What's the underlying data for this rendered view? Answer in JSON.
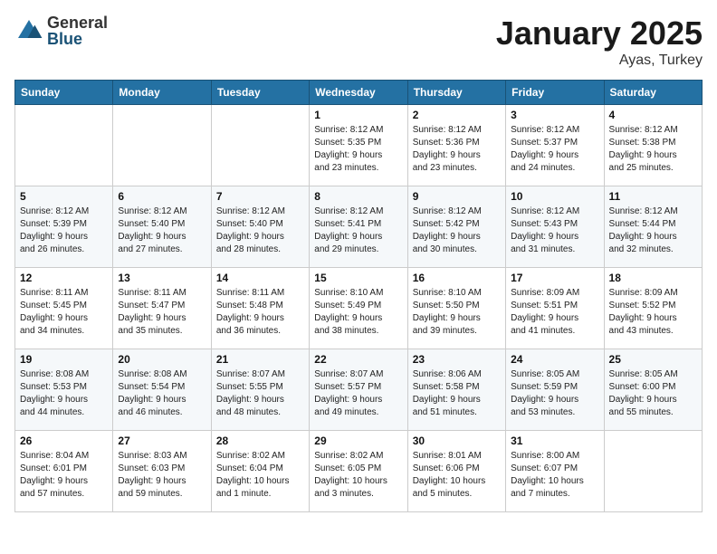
{
  "logo": {
    "general": "General",
    "blue": "Blue"
  },
  "title": "January 2025",
  "location": "Ayas, Turkey",
  "weekdays": [
    "Sunday",
    "Monday",
    "Tuesday",
    "Wednesday",
    "Thursday",
    "Friday",
    "Saturday"
  ],
  "weeks": [
    [
      {
        "day": "",
        "info": ""
      },
      {
        "day": "",
        "info": ""
      },
      {
        "day": "",
        "info": ""
      },
      {
        "day": "1",
        "info": "Sunrise: 8:12 AM\nSunset: 5:35 PM\nDaylight: 9 hours\nand 23 minutes."
      },
      {
        "day": "2",
        "info": "Sunrise: 8:12 AM\nSunset: 5:36 PM\nDaylight: 9 hours\nand 23 minutes."
      },
      {
        "day": "3",
        "info": "Sunrise: 8:12 AM\nSunset: 5:37 PM\nDaylight: 9 hours\nand 24 minutes."
      },
      {
        "day": "4",
        "info": "Sunrise: 8:12 AM\nSunset: 5:38 PM\nDaylight: 9 hours\nand 25 minutes."
      }
    ],
    [
      {
        "day": "5",
        "info": "Sunrise: 8:12 AM\nSunset: 5:39 PM\nDaylight: 9 hours\nand 26 minutes."
      },
      {
        "day": "6",
        "info": "Sunrise: 8:12 AM\nSunset: 5:40 PM\nDaylight: 9 hours\nand 27 minutes."
      },
      {
        "day": "7",
        "info": "Sunrise: 8:12 AM\nSunset: 5:40 PM\nDaylight: 9 hours\nand 28 minutes."
      },
      {
        "day": "8",
        "info": "Sunrise: 8:12 AM\nSunset: 5:41 PM\nDaylight: 9 hours\nand 29 minutes."
      },
      {
        "day": "9",
        "info": "Sunrise: 8:12 AM\nSunset: 5:42 PM\nDaylight: 9 hours\nand 30 minutes."
      },
      {
        "day": "10",
        "info": "Sunrise: 8:12 AM\nSunset: 5:43 PM\nDaylight: 9 hours\nand 31 minutes."
      },
      {
        "day": "11",
        "info": "Sunrise: 8:12 AM\nSunset: 5:44 PM\nDaylight: 9 hours\nand 32 minutes."
      }
    ],
    [
      {
        "day": "12",
        "info": "Sunrise: 8:11 AM\nSunset: 5:45 PM\nDaylight: 9 hours\nand 34 minutes."
      },
      {
        "day": "13",
        "info": "Sunrise: 8:11 AM\nSunset: 5:47 PM\nDaylight: 9 hours\nand 35 minutes."
      },
      {
        "day": "14",
        "info": "Sunrise: 8:11 AM\nSunset: 5:48 PM\nDaylight: 9 hours\nand 36 minutes."
      },
      {
        "day": "15",
        "info": "Sunrise: 8:10 AM\nSunset: 5:49 PM\nDaylight: 9 hours\nand 38 minutes."
      },
      {
        "day": "16",
        "info": "Sunrise: 8:10 AM\nSunset: 5:50 PM\nDaylight: 9 hours\nand 39 minutes."
      },
      {
        "day": "17",
        "info": "Sunrise: 8:09 AM\nSunset: 5:51 PM\nDaylight: 9 hours\nand 41 minutes."
      },
      {
        "day": "18",
        "info": "Sunrise: 8:09 AM\nSunset: 5:52 PM\nDaylight: 9 hours\nand 43 minutes."
      }
    ],
    [
      {
        "day": "19",
        "info": "Sunrise: 8:08 AM\nSunset: 5:53 PM\nDaylight: 9 hours\nand 44 minutes."
      },
      {
        "day": "20",
        "info": "Sunrise: 8:08 AM\nSunset: 5:54 PM\nDaylight: 9 hours\nand 46 minutes."
      },
      {
        "day": "21",
        "info": "Sunrise: 8:07 AM\nSunset: 5:55 PM\nDaylight: 9 hours\nand 48 minutes."
      },
      {
        "day": "22",
        "info": "Sunrise: 8:07 AM\nSunset: 5:57 PM\nDaylight: 9 hours\nand 49 minutes."
      },
      {
        "day": "23",
        "info": "Sunrise: 8:06 AM\nSunset: 5:58 PM\nDaylight: 9 hours\nand 51 minutes."
      },
      {
        "day": "24",
        "info": "Sunrise: 8:05 AM\nSunset: 5:59 PM\nDaylight: 9 hours\nand 53 minutes."
      },
      {
        "day": "25",
        "info": "Sunrise: 8:05 AM\nSunset: 6:00 PM\nDaylight: 9 hours\nand 55 minutes."
      }
    ],
    [
      {
        "day": "26",
        "info": "Sunrise: 8:04 AM\nSunset: 6:01 PM\nDaylight: 9 hours\nand 57 minutes."
      },
      {
        "day": "27",
        "info": "Sunrise: 8:03 AM\nSunset: 6:03 PM\nDaylight: 9 hours\nand 59 minutes."
      },
      {
        "day": "28",
        "info": "Sunrise: 8:02 AM\nSunset: 6:04 PM\nDaylight: 10 hours\nand 1 minute."
      },
      {
        "day": "29",
        "info": "Sunrise: 8:02 AM\nSunset: 6:05 PM\nDaylight: 10 hours\nand 3 minutes."
      },
      {
        "day": "30",
        "info": "Sunrise: 8:01 AM\nSunset: 6:06 PM\nDaylight: 10 hours\nand 5 minutes."
      },
      {
        "day": "31",
        "info": "Sunrise: 8:00 AM\nSunset: 6:07 PM\nDaylight: 10 hours\nand 7 minutes."
      },
      {
        "day": "",
        "info": ""
      }
    ]
  ]
}
